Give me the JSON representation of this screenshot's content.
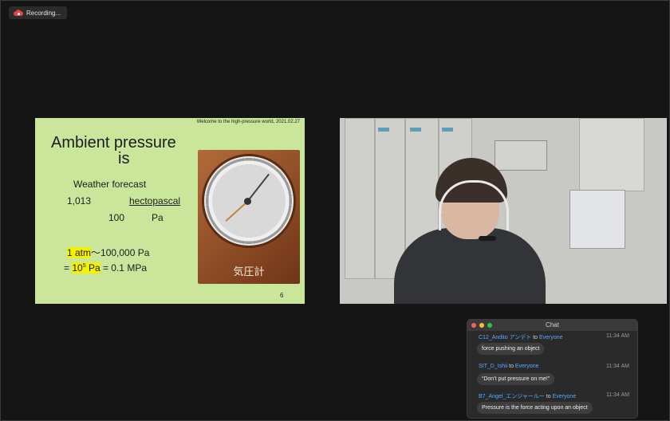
{
  "recording": {
    "label": "Recording..."
  },
  "slide": {
    "caption": "Welcome to the high-pressure world, 2021.02.27",
    "title_line1": "Ambient pressure",
    "title_line2": "is",
    "weather_forecast": "Weather forecast",
    "value_1013": "1,013",
    "unit_hectopascal": "hectopascal",
    "value_100": "100",
    "unit_pa": "Pa",
    "atm_label": "1 atm",
    "atm_rest": "〜100,000 Pa",
    "eq_prefix": "= ",
    "eq_base": "10",
    "eq_exp": "5",
    "eq_unit": " Pa",
    "eq_rest": " = 0.1 MPa",
    "barometer_label": "気圧計",
    "page_number": "6",
    "highlight_color": "#f5f200",
    "background_color": "#c9e69a"
  },
  "chat": {
    "title": "Chat",
    "messages": [
      {
        "sender": "C12_Andito アンデト",
        "to": "to",
        "recipient": "Everyone",
        "time": "11:34 AM",
        "text": "force pushing an object"
      },
      {
        "sender": "SIT_D_Ishii",
        "to": "to",
        "recipient": "Everyone",
        "time": "11:34 AM",
        "text": "“Don’t put pressure on me!”"
      },
      {
        "sender": "B7_Angel_エンジャールー",
        "to": "to",
        "recipient": "Everyone",
        "time": "11:34 AM",
        "text": "Pressure is the force acting upon an object"
      }
    ]
  },
  "icons": {
    "recording": "cloud-record-icon",
    "close": "close-dot-icon",
    "minimize": "minimize-dot-icon",
    "maximize": "maximize-dot-icon"
  },
  "colors": {
    "sender_name": "#5aa8ff",
    "traffic_close": "#ff5f57",
    "traffic_min": "#febc2e",
    "traffic_max": "#28c840"
  }
}
